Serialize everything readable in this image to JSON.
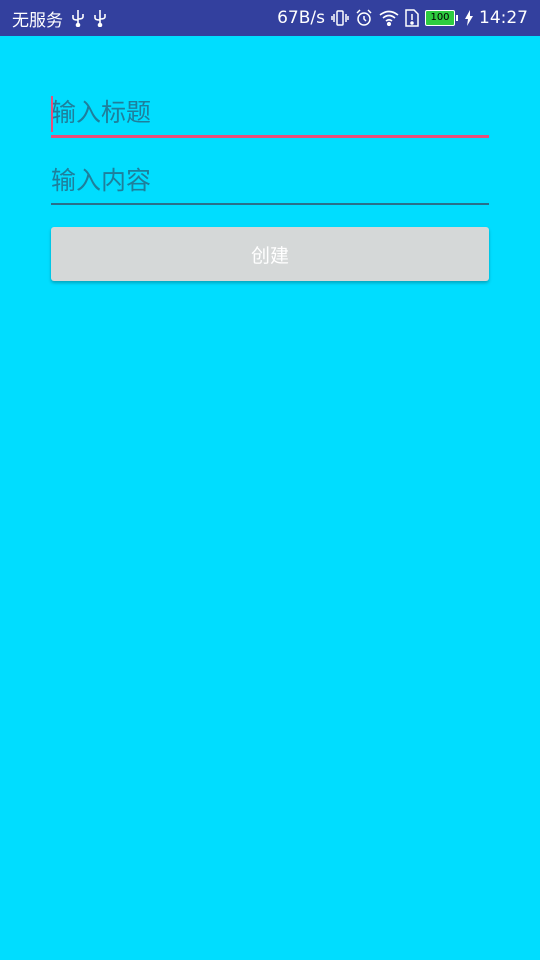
{
  "status_bar": {
    "carrier": "无服务",
    "speed": "67B/s",
    "battery": "100",
    "time": "14:27",
    "icons": [
      "usb-icon",
      "usb-icon",
      "vibrate-icon",
      "alarm-icon",
      "wifi-icon",
      "sim-alert-icon",
      "battery-icon",
      "charging-icon"
    ]
  },
  "form": {
    "title_placeholder": "输入标题",
    "title_value": "",
    "content_placeholder": "输入内容",
    "content_value": "",
    "create_label": "创建"
  },
  "colors": {
    "background": "#00DDFF",
    "status_bar": "#33409E",
    "accent": "#E94E7B",
    "button": "#D5D8D8"
  }
}
